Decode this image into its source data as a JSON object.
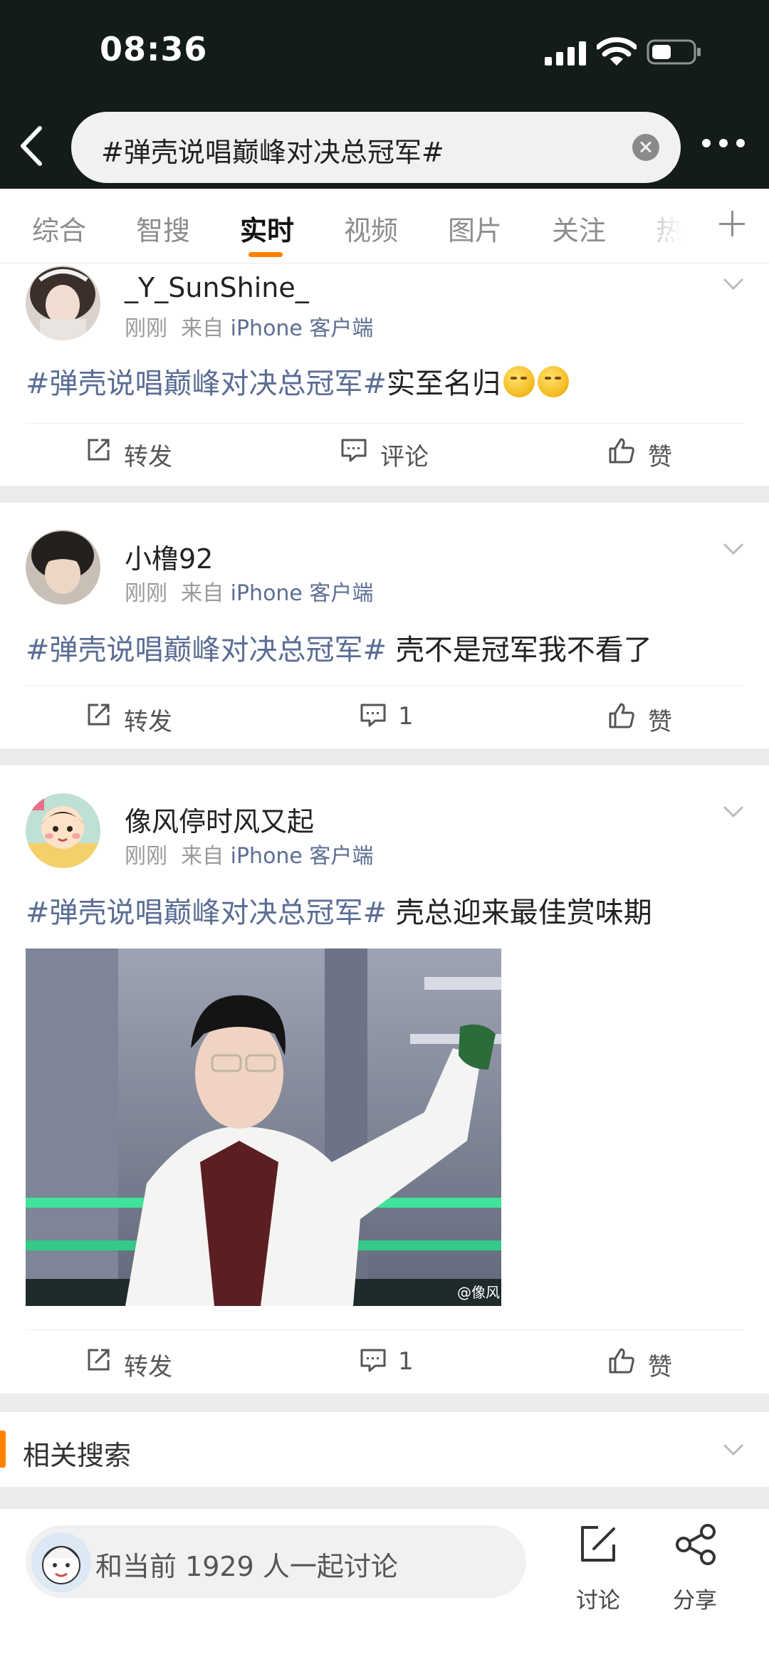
{
  "status_bar": {
    "time": "08:36"
  },
  "search": {
    "query": "#弹壳说唱巅峰对决总冠军#"
  },
  "tabs": [
    {
      "label": "综合"
    },
    {
      "label": "智搜"
    },
    {
      "label": "实时",
      "active": true
    },
    {
      "label": "视频"
    },
    {
      "label": "图片"
    },
    {
      "label": "关注"
    },
    {
      "label": "热"
    }
  ],
  "posts": [
    {
      "username": "_Y_SunShine_",
      "time": "刚刚",
      "from_prefix": "来自",
      "source": "iPhone 客户端",
      "hashtag": "#弹壳说唱巅峰对决总冠军#",
      "text": "实至名归",
      "emoji": [
        "thinking-face-icon",
        "thinking-face-icon"
      ],
      "repost_label": "转发",
      "comment_label": "评论",
      "like_label": "赞"
    },
    {
      "username": "小橹92",
      "time": "刚刚",
      "from_prefix": "来自",
      "source": "iPhone 客户端",
      "hashtag": "#弹壳说唱巅峰对决总冠军#",
      "text": " 壳不是冠军我不看了",
      "repost_label": "转发",
      "comment_label": "1",
      "like_label": "赞"
    },
    {
      "username": "像风停时风又起",
      "time": "刚刚",
      "from_prefix": "来自",
      "source": "iPhone 客户端",
      "hashtag": "#弹壳说唱巅峰对决总冠军#",
      "text": " 壳总迎来最佳赏味期",
      "image_watermark": "@像风",
      "repost_label": "转发",
      "comment_label": "1",
      "like_label": "赞"
    }
  ],
  "related": {
    "title": "相关搜索"
  },
  "bottom_bar": {
    "discuss_text": "和当前 1929 人一起讨论",
    "discuss_label": "讨论",
    "share_label": "分享"
  },
  "colors": {
    "accent": "#ff8200",
    "hashtag": "#5b6d95",
    "status_bg": "#141c18"
  }
}
